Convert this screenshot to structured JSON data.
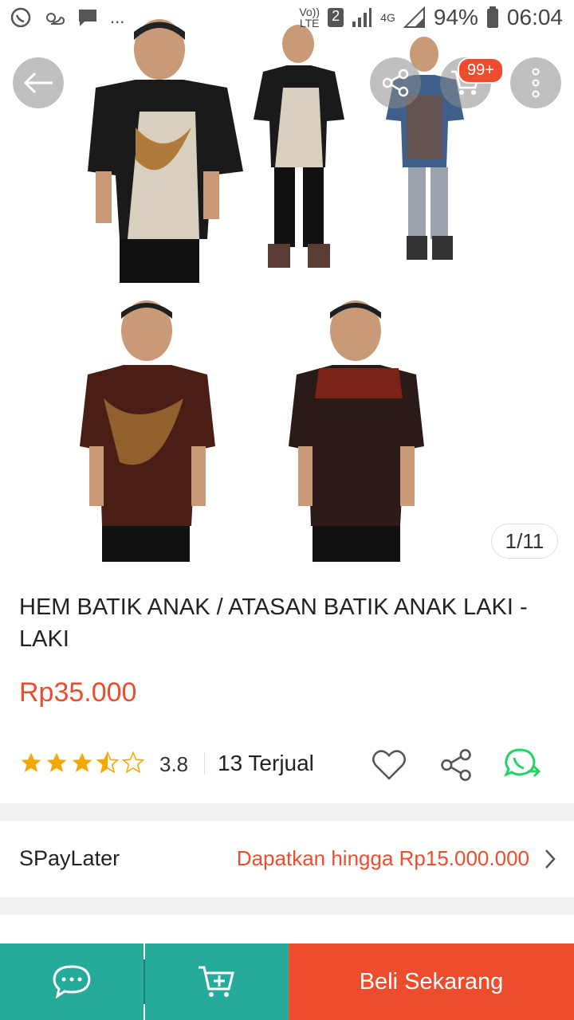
{
  "status_bar": {
    "left_icons": [
      "whatsapp-icon",
      "weather-icon",
      "message-icon"
    ],
    "overflow": "...",
    "network_label": "Vo)) LTE",
    "sim": "2",
    "data_type": "4G",
    "battery": "94%",
    "time": "06:04"
  },
  "product": {
    "image_counter": "1/11",
    "title": "HEM BATIK ANAK / ATASAN BATIK ANAK LAKI - LAKI",
    "price": "Rp35.000",
    "rating": 3.8,
    "rating_label": "3.8",
    "stars_filled": 3.5,
    "sold": "13 Terjual"
  },
  "header": {
    "cart_badge": "99+"
  },
  "spaylater": {
    "label": "SPayLater",
    "offer": "Dapatkan hingga Rp15.000.000"
  },
  "bottom_bar": {
    "buy_label": "Beli Sekarang"
  },
  "colors": {
    "accent": "#ee4d2d",
    "teal": "#26aa99",
    "whatsapp": "#25d366",
    "star": "#f6a700"
  }
}
